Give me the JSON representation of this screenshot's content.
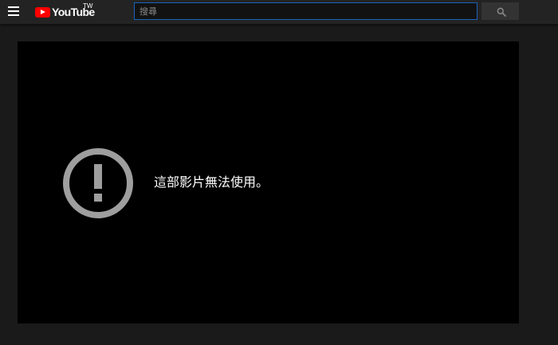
{
  "masthead": {
    "logo_text": "YouTube",
    "region_label": "TW",
    "search_placeholder": "搜尋",
    "icons": {
      "menu": "hamburger-menu-icon",
      "logo": "youtube-play-icon",
      "search": "magnifier-icon"
    }
  },
  "player": {
    "error_message": "這部影片無法使用。",
    "error_icon": "exclamation-circle-icon"
  },
  "colors": {
    "logo_red": "#ff0000",
    "search_border": "#1c62b9",
    "page_background": "#1a1a1a",
    "player_background": "#000000",
    "error_icon": "#9e9e9e"
  }
}
